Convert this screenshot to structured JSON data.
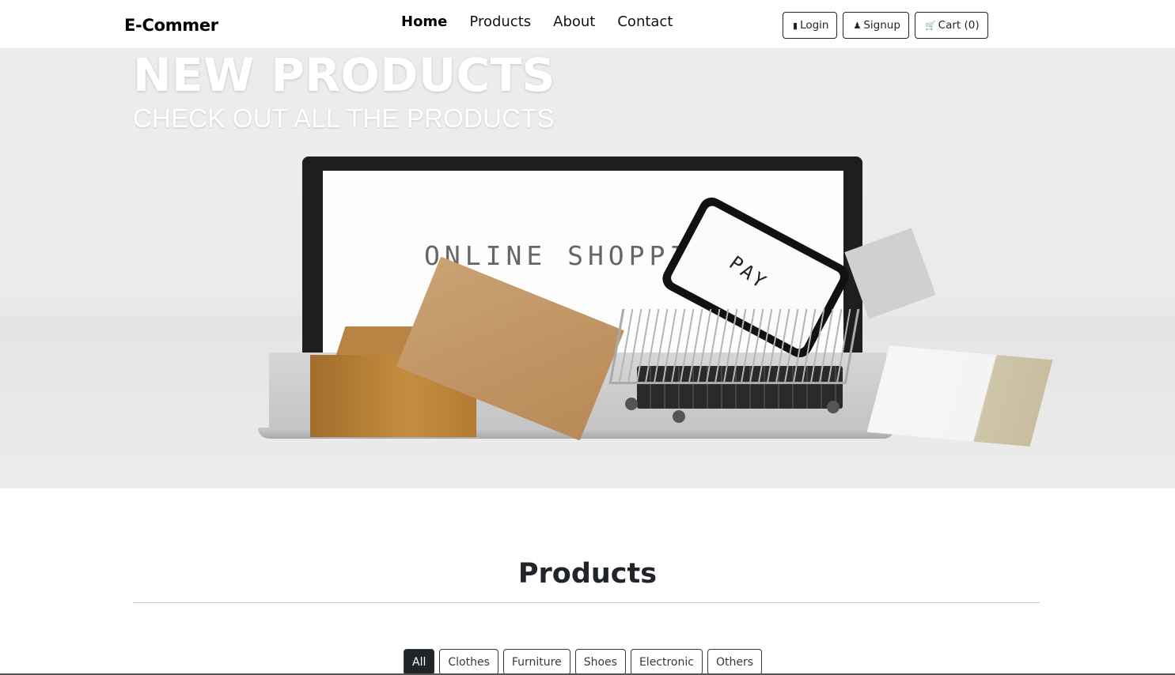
{
  "navbar": {
    "brand": "E-Commer",
    "links": [
      {
        "label": "Home",
        "active": true
      },
      {
        "label": "Products"
      },
      {
        "label": "About"
      },
      {
        "label": "Contact"
      }
    ],
    "buttons": {
      "login": {
        "icon": "login-icon",
        "label": "Login"
      },
      "signup": {
        "icon": "user-plus-icon",
        "label": "Signup"
      },
      "cart": {
        "icon": "cart-icon",
        "label": "Cart (0)"
      }
    }
  },
  "hero": {
    "title": "NEW PRODUCTS",
    "subtitle": "CHECK OUT ALL THE PRODUCTS",
    "image_screen_text": "ONLINE SHOPPING",
    "image_phone_text": "PAY"
  },
  "products": {
    "heading": "Products",
    "filters": [
      "All",
      "Clothes",
      "Furniture",
      "Shoes",
      "Electronic",
      "Others"
    ],
    "active_filter": "All"
  },
  "colors": {
    "dark": "#212529",
    "white": "#ffffff"
  }
}
